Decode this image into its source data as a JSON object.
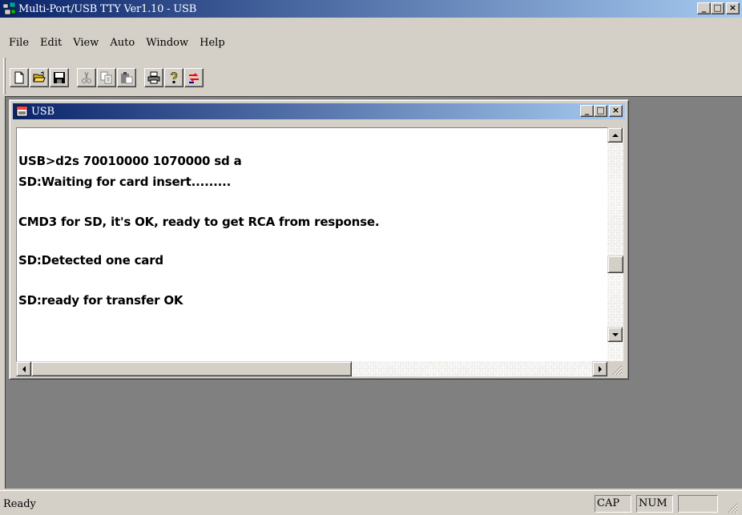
{
  "app": {
    "title": "Multi-Port/USB TTY Ver1.10 - USB",
    "icon": "usb-tty-app-icon"
  },
  "caption_buttons": {
    "minimize": "_",
    "maximize": "□",
    "close": "×"
  },
  "menu": {
    "items": [
      {
        "label": "File"
      },
      {
        "label": "Edit"
      },
      {
        "label": "View"
      },
      {
        "label": "Auto"
      },
      {
        "label": "Window"
      },
      {
        "label": "Help"
      }
    ]
  },
  "toolbar": {
    "buttons": [
      {
        "icon": "new-file-icon"
      },
      {
        "icon": "open-folder-icon"
      },
      {
        "icon": "save-disk-icon"
      },
      {
        "icon": "cut-scissors-icon"
      },
      {
        "icon": "copy-icon"
      },
      {
        "icon": "paste-icon"
      },
      {
        "icon": "print-icon"
      },
      {
        "icon": "help-question-icon"
      },
      {
        "icon": "transfer-icon"
      }
    ]
  },
  "child_window": {
    "title": "USB",
    "icon": "doc-icon",
    "lines": [
      "USB>d2s 70010000 1070000 sd a",
      "SD:Waiting for card insert.........",
      "CMD3 for SD, it's OK, ready to get RCA from response.",
      "SD:Detected one card",
      "SD:ready for transfer OK"
    ]
  },
  "statusbar": {
    "text": "Ready",
    "cap": "CAP",
    "num": "NUM",
    "scrl": ""
  },
  "colors": {
    "face": "#d4d0c8",
    "title_active_start": "#0a246a",
    "title_active_end": "#a6caf0",
    "workspace": "#808080"
  }
}
